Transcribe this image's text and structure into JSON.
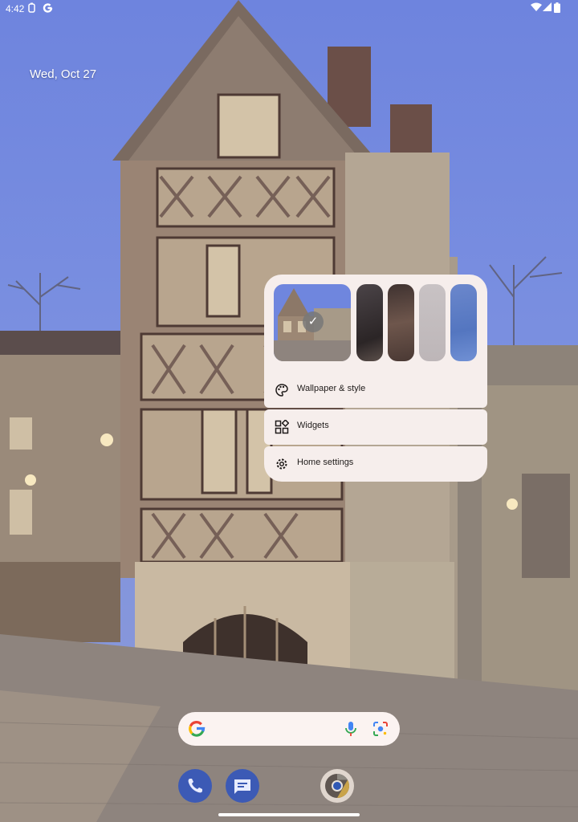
{
  "status_bar": {
    "time": "4:42",
    "left_icons": [
      "notification-icon",
      "google-icon"
    ],
    "right_icons": [
      "wifi-icon",
      "signal-icon",
      "battery-icon"
    ]
  },
  "date_widget": {
    "text": "Wed, Oct 27"
  },
  "popup_menu": {
    "wallpaper_thumbnails": [
      {
        "name": "current",
        "selected": true
      },
      {
        "name": "dark-wall",
        "selected": false
      },
      {
        "name": "brown-wall",
        "selected": false
      },
      {
        "name": "light-grey",
        "selected": false
      },
      {
        "name": "blue-wall",
        "selected": false
      }
    ],
    "items": [
      {
        "label": "Wallpaper & style",
        "icon": "palette-icon"
      },
      {
        "label": "Widgets",
        "icon": "widgets-icon"
      },
      {
        "label": "Home settings",
        "icon": "gear-icon"
      }
    ]
  },
  "search_bar": {
    "icons": [
      "google-g-icon",
      "mic-icon",
      "lens-icon"
    ]
  },
  "dock": {
    "apps": [
      "Phone",
      "Messages",
      "Chrome"
    ]
  },
  "colors": {
    "accent": "#3c5ab5",
    "menu_bg": "#f6eeec",
    "sky": "#7088de"
  }
}
